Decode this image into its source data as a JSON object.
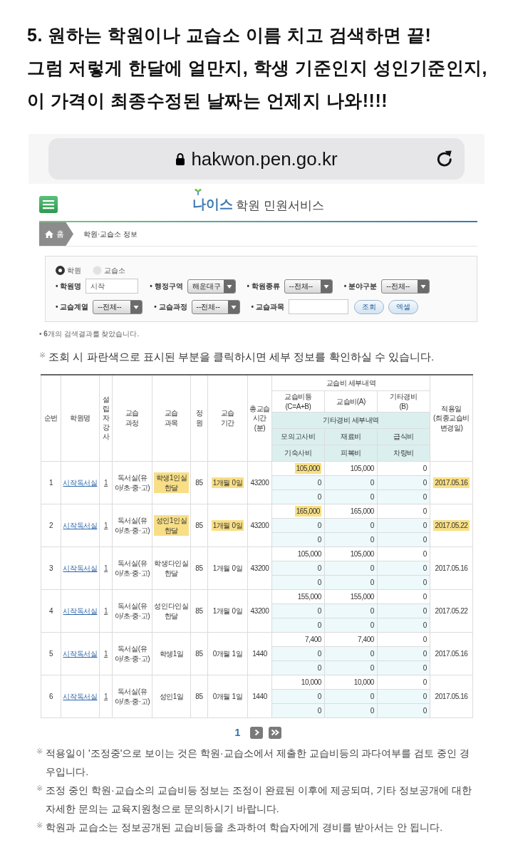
{
  "caption": {
    "lines": [
      "5. 원하는 학원이나 교습소 이름 치고 검색하면 끝!",
      "그럼 저렇게 한달에 얼만지, 학생 기준인지 성인기준인지,",
      "이 가격이 최종수정된 날짜는 언제지 나와!!!!"
    ]
  },
  "browser": {
    "url": "hakwon.pen.go.kr"
  },
  "site": {
    "logo": "나이스",
    "title": "학원 민원서비스"
  },
  "breadcrumb": [
    {
      "kind": "home",
      "label": "홈"
    },
    {
      "kind": "page",
      "label": "학원·교습소 정보"
    }
  ],
  "search": {
    "types": [
      {
        "label": "학원",
        "selected": true
      },
      {
        "label": "교습소",
        "selected": false
      }
    ],
    "rows": [
      [
        {
          "kind": "text",
          "label": "• 학원명",
          "value": "시작"
        },
        {
          "kind": "select",
          "label": "• 행정구역",
          "value": "해운대구"
        },
        {
          "kind": "select",
          "label": "• 학원종류",
          "value": "--전체--"
        },
        {
          "kind": "select",
          "label": "• 분야구분",
          "value": "--전체--"
        }
      ],
      [
        {
          "kind": "select",
          "label": "• 교습계열",
          "value": "--전체--"
        },
        {
          "kind": "select",
          "label": "• 교습과정",
          "value": "--전체--"
        },
        {
          "kind": "text",
          "label": "• 교습과목"
        }
      ]
    ],
    "buttons": [
      "조회",
      "엑셀"
    ]
  },
  "result_count": "• **6**개의 검색결과를 찾았습니다.",
  "hint": {
    "mark": "※",
    "text": "조회 시 파란색으로 표시된 부분을 클릭하시면 세부 정보를 확인하실 수 있습니다."
  },
  "table": {
    "columns": [
      {
        "kind": "plain",
        "label": "순번"
      },
      {
        "kind": "plain",
        "label": "학원명"
      },
      {
        "kind": "vertical",
        "label": "설립자강사"
      },
      {
        "kind": "plain",
        "label": "교습\n과정"
      },
      {
        "kind": "plain",
        "label": "교습\n과목"
      },
      {
        "kind": "plain",
        "label": "정원"
      },
      {
        "kind": "plain",
        "label": "교습\n기간"
      },
      {
        "kind": "plain",
        "label": "총교습\n시간\n(분)"
      },
      {
        "kind": "group",
        "label": "교습비 세부내역",
        "columns": [
          "교습비등\n(C=A+B)",
          "교습비(A)",
          "기타경비\n(B)"
        ],
        "detail_label": "기타경비 세부내역",
        "detail_rows": [
          [
            "모의고사비",
            "재료비",
            "급식비"
          ],
          [
            "기숙사비",
            "피복비",
            "차량비"
          ]
        ]
      },
      {
        "kind": "plain",
        "label": "적용일\n(최종교습비변경일)"
      }
    ],
    "rows": [
      {
        "no": "1",
        "name": "시작독서실",
        "instructors": "1",
        "course": "독서실(유아/초·중·고)",
        "subject": "학생1인실 한달",
        "capacity": "85",
        "period": "1개월 0일",
        "minutes": "43200",
        "fees": [
          [
            "105,000",
            "105,000",
            "0"
          ],
          [
            "0",
            "0",
            "0"
          ],
          [
            "0",
            "0",
            "0"
          ]
        ],
        "date": "2017.05.16",
        "highlighted": true
      },
      {
        "no": "2",
        "name": "시작독서실",
        "instructors": "1",
        "course": "독서실(유아/초·중·고)",
        "subject": "성인1인실 한달",
        "capacity": "85",
        "period": "1개월 0일",
        "minutes": "43200",
        "fees": [
          [
            "165,000",
            "165,000",
            "0"
          ],
          [
            "0",
            "0",
            "0"
          ],
          [
            "0",
            "0",
            "0"
          ]
        ],
        "date": "2017.05.22",
        "highlighted": true
      },
      {
        "no": "3",
        "name": "시작독서실",
        "instructors": "1",
        "course": "독서실(유아/초·중·고)",
        "subject": "학생다인실 한달",
        "capacity": "85",
        "period": "1개월 0일",
        "minutes": "43200",
        "fees": [
          [
            "105,000",
            "105,000",
            "0"
          ],
          [
            "0",
            "0",
            "0"
          ],
          [
            "0",
            "0",
            "0"
          ]
        ],
        "date": "2017.05.16",
        "highlighted": false
      },
      {
        "no": "4",
        "name": "시작독서실",
        "instructors": "1",
        "course": "독서실(유아/초·중·고)",
        "subject": "성인다인실 한달",
        "capacity": "85",
        "period": "1개월 0일",
        "minutes": "43200",
        "fees": [
          [
            "155,000",
            "155,000",
            "0"
          ],
          [
            "0",
            "0",
            "0"
          ],
          [
            "0",
            "0",
            "0"
          ]
        ],
        "date": "2017.05.22",
        "highlighted": false
      },
      {
        "no": "5",
        "name": "시작독서실",
        "instructors": "1",
        "course": "독서실(유아/초·중·고)",
        "subject": "학생1일",
        "capacity": "85",
        "period": "0개월 1일",
        "minutes": "1440",
        "fees": [
          [
            "7,400",
            "7,400",
            "0"
          ],
          [
            "0",
            "0",
            "0"
          ],
          [
            "0",
            "0",
            "0"
          ]
        ],
        "date": "2017.05.16",
        "highlighted": false
      },
      {
        "no": "6",
        "name": "시작독서실",
        "instructors": "1",
        "course": "독서실(유아/초·중·고)",
        "subject": "성인1일",
        "capacity": "85",
        "period": "0개월 1일",
        "minutes": "1440",
        "fees": [
          [
            "10,000",
            "10,000",
            "0"
          ],
          [
            "0",
            "0",
            "0"
          ],
          [
            "0",
            "0",
            "0"
          ]
        ],
        "date": "2017.05.16",
        "highlighted": false
      }
    ]
  },
  "pagination": {
    "pages": [
      {
        "label": "1",
        "selected": true
      }
    ]
  },
  "notes": [
    {
      "mark": "※",
      "text": "적용일이 '조정중'으로 보이는 것은 학원·교습소에서 제출한 교습비등의 과다여부를 검토 중인 경우입니다."
    },
    {
      "mark": "※",
      "text": "조정 중인 학원·교습소의 교습비등 정보는 조정이 완료된 이후에 제공되며, 기타 정보공개에 대한 자세한 문의는 교육지원청으로 문의하시기 바랍니다."
    },
    {
      "mark": "※",
      "text": "학원과 교습소는 정보공개된 교습비등을 초과하여 학습자에게 경비를 받아서는 안 됩니다."
    }
  ]
}
